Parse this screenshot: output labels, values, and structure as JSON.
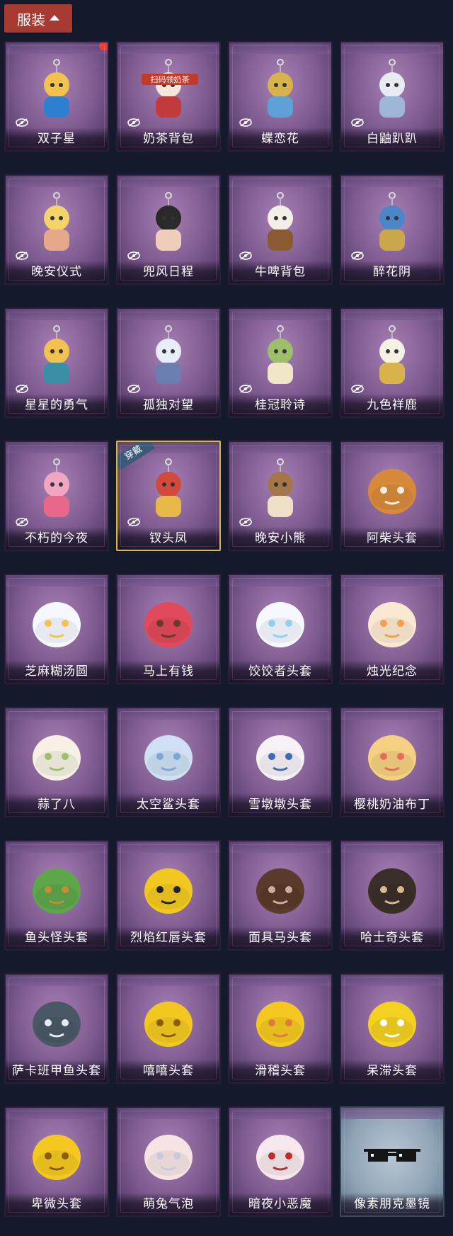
{
  "header": {
    "title": "服装"
  },
  "items": [
    {
      "label": "双子星",
      "icon": "gemini-keychain-icon",
      "hidden": true,
      "new": true
    },
    {
      "label": "奶茶背包",
      "icon": "milk-tea-bag-icon",
      "hidden": true,
      "qr_text": "扫码领奶茶"
    },
    {
      "label": "蝶恋花",
      "icon": "butterfly-bell-icon",
      "hidden": true
    },
    {
      "label": "白鼬趴趴",
      "icon": "white-weasel-icon",
      "hidden": true
    },
    {
      "label": "晚安仪式",
      "icon": "bedtime-doll-icon",
      "hidden": true
    },
    {
      "label": "兜风日程",
      "icon": "cap-doll-icon",
      "hidden": true
    },
    {
      "label": "牛啤背包",
      "icon": "cow-beer-bag-icon",
      "hidden": true
    },
    {
      "label": "醉花阴",
      "icon": "floral-wreath-icon",
      "hidden": true
    },
    {
      "label": "星星的勇气",
      "icon": "star-prince-icon",
      "hidden": true
    },
    {
      "label": "孤独对望",
      "icon": "lonely-girl-icon",
      "hidden": true
    },
    {
      "label": "桂冠聆诗",
      "icon": "laurel-doll-icon",
      "hidden": true
    },
    {
      "label": "九色祥鹿",
      "icon": "deer-charm-icon",
      "hidden": true
    },
    {
      "label": "不朽的今夜",
      "icon": "fox-sundae-icon",
      "hidden": true
    },
    {
      "label": "钗头凤",
      "icon": "phoenix-crown-icon",
      "hidden": true,
      "equipped": true,
      "equipped_text": "穿戴"
    },
    {
      "label": "晚安小熊",
      "icon": "teddy-bear-icon",
      "hidden": true
    },
    {
      "label": "阿柴头套",
      "icon": "shiba-head-icon",
      "hidden": false
    },
    {
      "label": "芝麻糊汤圆",
      "icon": "rice-ball-head-icon",
      "hidden": false
    },
    {
      "label": "马上有钱",
      "icon": "horse-mask-icon",
      "hidden": false
    },
    {
      "label": "饺饺者头套",
      "icon": "dumpling-head-icon",
      "hidden": false
    },
    {
      "label": "烛光纪念",
      "icon": "candle-head-icon",
      "hidden": false
    },
    {
      "label": "蒜了八",
      "icon": "garlic-head-icon",
      "hidden": false
    },
    {
      "label": "太空鲨头套",
      "icon": "shark-head-icon",
      "hidden": false
    },
    {
      "label": "雪墩墩头套",
      "icon": "snowman-head-icon",
      "hidden": false
    },
    {
      "label": "樱桃奶油布丁",
      "icon": "pudding-head-icon",
      "hidden": false
    },
    {
      "label": "鱼头怪头套",
      "icon": "fish-head-icon",
      "hidden": false
    },
    {
      "label": "烈焰红唇头套",
      "icon": "yellow-mask-icon",
      "hidden": false
    },
    {
      "label": "面具马头套",
      "icon": "horse-head-icon",
      "hidden": false
    },
    {
      "label": "哈士奇头套",
      "icon": "husky-head-icon",
      "hidden": false
    },
    {
      "label": "萨卡班甲鱼头套",
      "icon": "sacabambaspis-head-icon",
      "hidden": false
    },
    {
      "label": "嘻嘻头套",
      "icon": "grin-emoji-head-icon",
      "hidden": false
    },
    {
      "label": "滑稽头套",
      "icon": "sly-emoji-head-icon",
      "hidden": false
    },
    {
      "label": "呆滞头套",
      "icon": "stare-emoji-head-icon",
      "hidden": false
    },
    {
      "label": "卑微头套",
      "icon": "humble-emoji-head-icon",
      "hidden": false
    },
    {
      "label": "萌兔气泡",
      "icon": "bunny-bubble-icon",
      "hidden": false
    },
    {
      "label": "暗夜小恶魔",
      "icon": "devil-horns-icon",
      "hidden": false
    },
    {
      "label": "像素朋克墨镜",
      "icon": "pixel-sunglasses-icon",
      "hidden": false,
      "special": true
    }
  ],
  "colors": {
    "accent": "#a83a34",
    "card": "#7d5a8f",
    "background": "#141a2c",
    "equipped_border": "#d8b44c"
  }
}
